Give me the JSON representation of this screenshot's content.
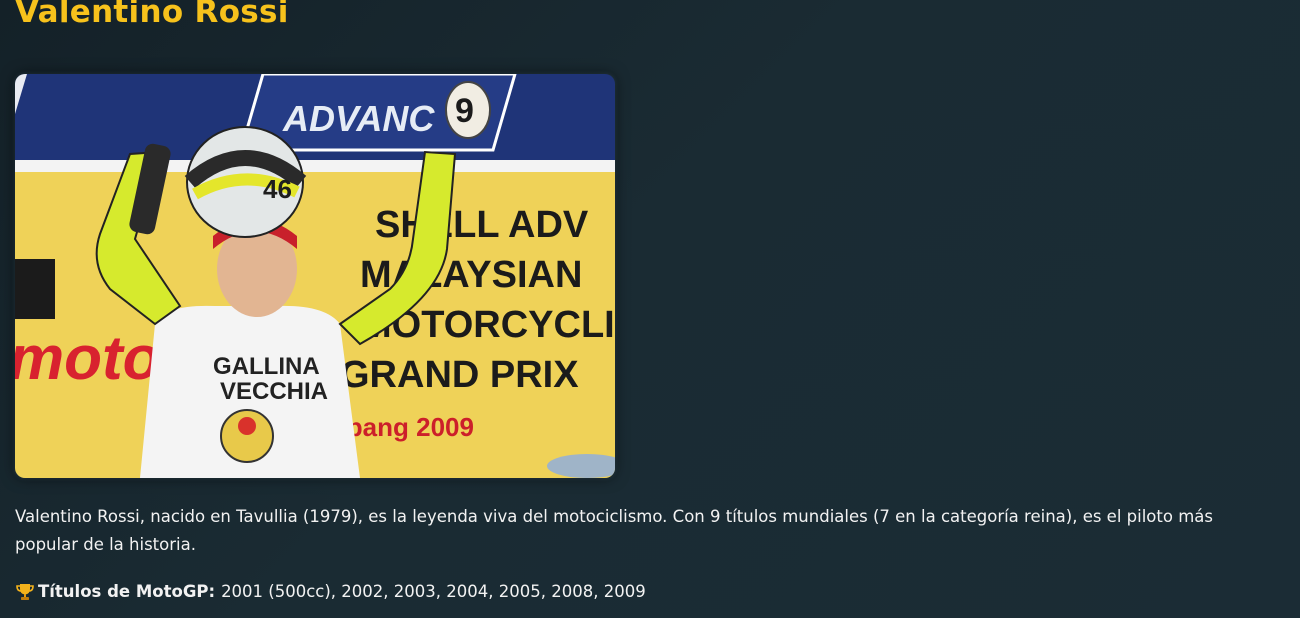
{
  "page": {
    "title": "Valentino Rossi"
  },
  "photo": {
    "banner_text": "ADVANC",
    "board_lines": [
      "SHELL ADV",
      "MALAYSIAN",
      "MOTORCYCLI",
      "GRAND PRIX"
    ],
    "board_year": "Sepang 2009",
    "side_text": "motor",
    "helmet_number": "46",
    "egg_number": "9",
    "shirt_text": [
      "GALLINA",
      "VECCHIA"
    ]
  },
  "bio": {
    "text": "Valentino Rossi, nacido en Tavullia (1979), es la leyenda viva del motociclismo. Con 9 títulos mundiales (7 en la categoría reina), es el piloto más popular de la historia."
  },
  "titles": {
    "icon": "trophy-icon",
    "label": "Títulos de MotoGP:",
    "value": "2001 (500cc), 2002, 2003, 2004, 2005, 2008, 2009"
  },
  "colors": {
    "accent": "#f7c21c",
    "background": "#172830",
    "text": "#f2f2f2"
  }
}
